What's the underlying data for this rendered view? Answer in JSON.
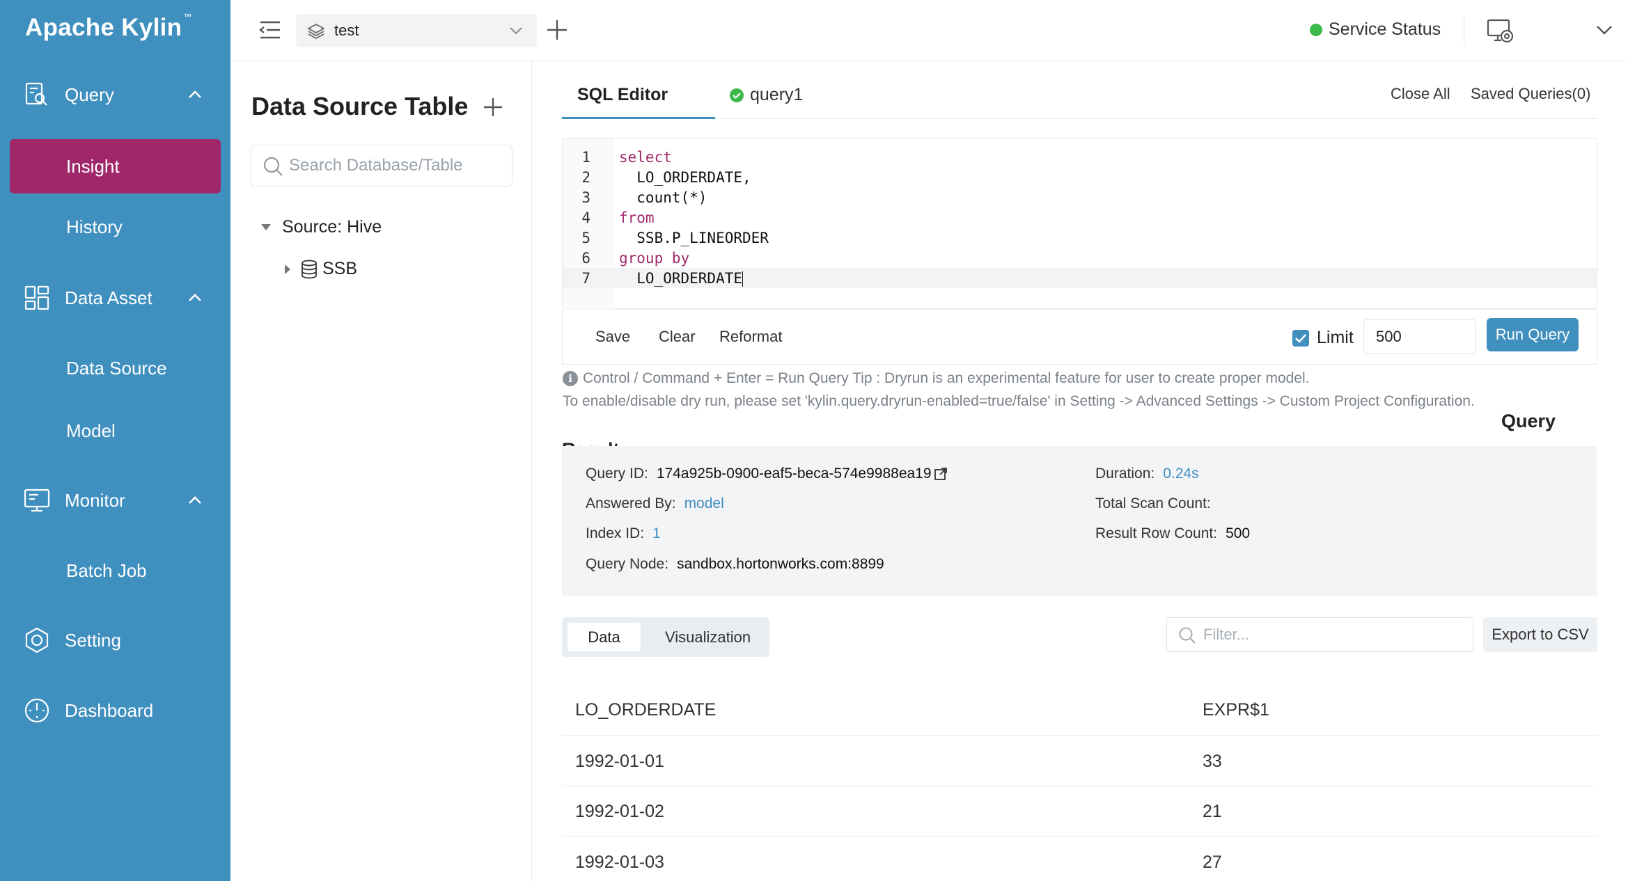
{
  "app": {
    "title": "Apache Kylin",
    "trademark": "™"
  },
  "sidebar": {
    "groups": [
      {
        "label": "Query",
        "icon": "query-icon"
      },
      {
        "label": "Data Asset",
        "icon": "data-asset-icon"
      },
      {
        "label": "Monitor",
        "icon": "monitor-icon"
      },
      {
        "label": "Setting",
        "icon": "setting-icon"
      },
      {
        "label": "Dashboard",
        "icon": "dashboard-icon"
      }
    ],
    "items": [
      "Insight",
      "History",
      "Data Source",
      "Model",
      "Batch Job"
    ],
    "active_color": "#a0286a",
    "bg_color": "#3f8fbf"
  },
  "topbar": {
    "project": "test",
    "service_status": "Service Status",
    "status_color": "#3db84a"
  },
  "datasource": {
    "title": "Data Source Table",
    "search_placeholder": "Search Database/Table",
    "source": "Source: Hive",
    "database": "SSB"
  },
  "editor": {
    "tabs": [
      "SQL Editor",
      "query1"
    ],
    "close_all": "Close All",
    "saved_queries": "Saved Queries(0)",
    "lines": [
      {
        "n": "1",
        "kw": "select",
        "text": ""
      },
      {
        "n": "2",
        "kw": "",
        "text": "  LO_ORDERDATE,"
      },
      {
        "n": "3",
        "kw": "",
        "text": "  count(*)"
      },
      {
        "n": "4",
        "kw": "from",
        "text": ""
      },
      {
        "n": "5",
        "kw": "",
        "text": "  SSB.P_LINEORDER"
      },
      {
        "n": "6",
        "kw": "group by",
        "text": ""
      },
      {
        "n": "7",
        "kw": "",
        "text": "  LO_ORDERDATE"
      }
    ],
    "actions": [
      "Save",
      "Clear",
      "Reformat"
    ],
    "limit_label": "Limit",
    "limit_value": "500",
    "run_label": "Run Query"
  },
  "tips": {
    "line1": "Control / Command + Enter = Run Query Tip : Dryrun is an experimental feature for user to create proper model.",
    "line2": "To enable/disable dry run, please set 'kylin.query.dryrun-enabled=true/false' in Setting -> Advanced Settings -> Custom Project Configuration."
  },
  "query_label": "Query",
  "result_heading": "Result",
  "result": {
    "query_id_label": "Query ID:",
    "query_id": "174a925b-0900-eaf5-beca-574e9988ea19",
    "answered_by_label": "Answered By:",
    "answered_by": "model",
    "index_id_label": "Index ID:",
    "index_id": "1",
    "query_node_label": "Query Node:",
    "query_node": "sandbox.hortonworks.com:8899",
    "duration_label": "Duration:",
    "duration": "0.24s",
    "scan_count_label": "Total Scan Count:",
    "row_count_label": "Result Row Count:",
    "row_count": "500"
  },
  "results_view": {
    "tabs": [
      "Data",
      "Visualization"
    ],
    "filter_placeholder": "Filter...",
    "export_label": "Export to CSV"
  },
  "table": {
    "columns": [
      "LO_ORDERDATE",
      "EXPR$1"
    ],
    "rows": [
      [
        "1992-01-01",
        "33"
      ],
      [
        "1992-01-02",
        "21"
      ],
      [
        "1992-01-03",
        "27"
      ]
    ]
  }
}
